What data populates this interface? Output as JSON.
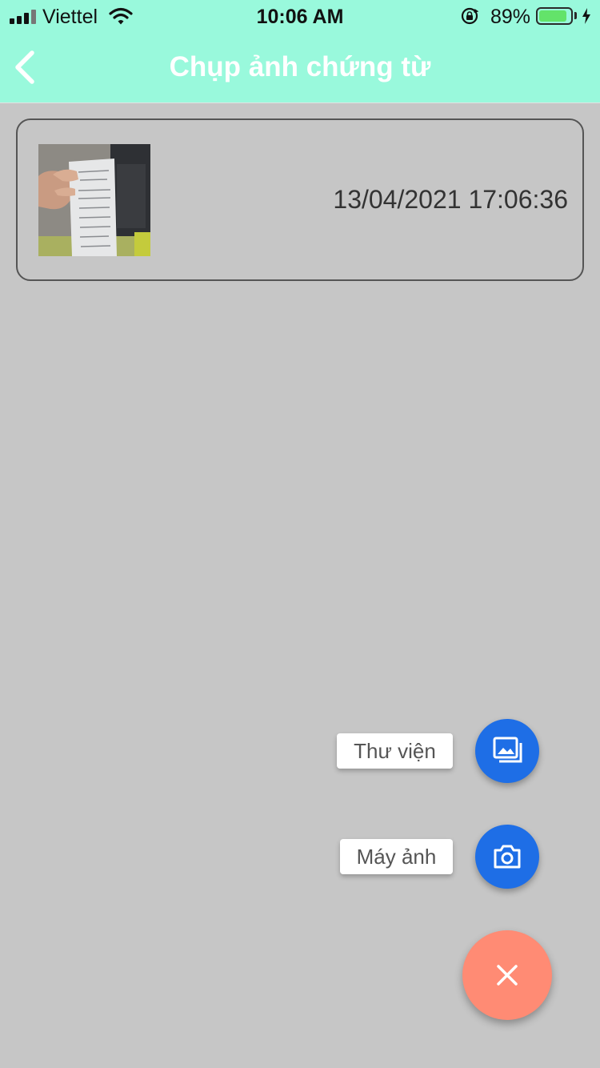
{
  "status_bar": {
    "carrier": "Viettel",
    "time": "10:06 AM",
    "battery_percent": "89%",
    "battery_level": 0.89,
    "icons": [
      "signal-icon",
      "wifi-icon",
      "rotation-lock-icon",
      "battery-icon",
      "charging-icon"
    ]
  },
  "nav": {
    "title": "Chụp ảnh chứng từ",
    "back_icon": "chevron-left-icon"
  },
  "documents": [
    {
      "thumbnail": "receipt-photo",
      "timestamp": "13/04/2021 17:06:36"
    }
  ],
  "fab_menu": {
    "library_label": "Thư viện",
    "library_icon": "photo-library-icon",
    "camera_label": "Máy ảnh",
    "camera_icon": "camera-icon",
    "close_icon": "close-icon"
  },
  "colors": {
    "header_bg": "#99f9dc",
    "page_bg": "#c6c6c6",
    "mini_fab": "#1e6ee6",
    "main_fab": "#ff8b74"
  }
}
